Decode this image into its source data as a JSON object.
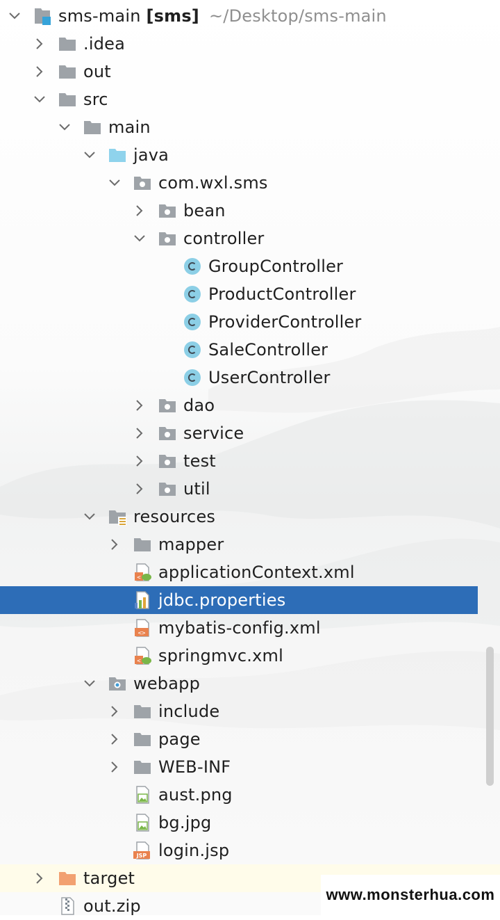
{
  "project": {
    "root": {
      "name": "sms-main",
      "module": "[sms]",
      "path": "~/Desktop/sms-main"
    }
  },
  "tree": [
    {
      "label": "sms-main [sms]  ~/Desktop/sms-main",
      "name": "root",
      "level": 0,
      "chev": "down",
      "icon": "module",
      "kind": "root"
    },
    {
      "label": ".idea",
      "name": "idea",
      "level": 1,
      "chev": "right",
      "icon": "folder-gray"
    },
    {
      "label": "out",
      "name": "out",
      "level": 1,
      "chev": "right",
      "icon": "folder-gray"
    },
    {
      "label": "src",
      "name": "src",
      "level": 1,
      "chev": "down",
      "icon": "folder-gray"
    },
    {
      "label": "main",
      "name": "main",
      "level": 2,
      "chev": "down",
      "icon": "folder-gray"
    },
    {
      "label": "java",
      "name": "java",
      "level": 3,
      "chev": "down",
      "icon": "folder-source"
    },
    {
      "label": "com.wxl.sms",
      "name": "com-wxl-sms",
      "level": 4,
      "chev": "down",
      "icon": "package"
    },
    {
      "label": "bean",
      "name": "bean",
      "level": 5,
      "chev": "right",
      "icon": "package"
    },
    {
      "label": "controller",
      "name": "controller",
      "level": 5,
      "chev": "down",
      "icon": "package"
    },
    {
      "label": "GroupController",
      "name": "group-controller",
      "level": 6,
      "chev": "none",
      "icon": "class"
    },
    {
      "label": "ProductController",
      "name": "product-controller",
      "level": 6,
      "chev": "none",
      "icon": "class"
    },
    {
      "label": "ProviderController",
      "name": "provider-controller",
      "level": 6,
      "chev": "none",
      "icon": "class"
    },
    {
      "label": "SaleController",
      "name": "sale-controller",
      "level": 6,
      "chev": "none",
      "icon": "class"
    },
    {
      "label": "UserController",
      "name": "user-controller",
      "level": 6,
      "chev": "none",
      "icon": "class"
    },
    {
      "label": "dao",
      "name": "dao",
      "level": 5,
      "chev": "right",
      "icon": "package"
    },
    {
      "label": "service",
      "name": "service",
      "level": 5,
      "chev": "right",
      "icon": "package"
    },
    {
      "label": "test",
      "name": "test",
      "level": 5,
      "chev": "right",
      "icon": "package"
    },
    {
      "label": "util",
      "name": "util",
      "level": 5,
      "chev": "right",
      "icon": "package"
    },
    {
      "label": "resources",
      "name": "resources",
      "level": 3,
      "chev": "down",
      "icon": "folder-resources"
    },
    {
      "label": "mapper",
      "name": "mapper",
      "level": 4,
      "chev": "right",
      "icon": "folder-gray"
    },
    {
      "label": "applicationContext.xml",
      "name": "application-context-xml",
      "level": 4,
      "chev": "none",
      "icon": "xml-spring"
    },
    {
      "label": "jdbc.properties",
      "name": "jdbc-properties",
      "level": 4,
      "chev": "none",
      "icon": "properties",
      "state": "selected"
    },
    {
      "label": "mybatis-config.xml",
      "name": "mybatis-config-xml",
      "level": 4,
      "chev": "none",
      "icon": "xml"
    },
    {
      "label": "springmvc.xml",
      "name": "springmvc-xml",
      "level": 4,
      "chev": "none",
      "icon": "xml-spring"
    },
    {
      "label": "webapp",
      "name": "webapp",
      "level": 3,
      "chev": "down",
      "icon": "folder-web"
    },
    {
      "label": "include",
      "name": "include",
      "level": 4,
      "chev": "right",
      "icon": "folder-gray"
    },
    {
      "label": "page",
      "name": "page",
      "level": 4,
      "chev": "right",
      "icon": "folder-gray"
    },
    {
      "label": "WEB-INF",
      "name": "web-inf",
      "level": 4,
      "chev": "right",
      "icon": "folder-gray"
    },
    {
      "label": "aust.png",
      "name": "aust-png",
      "level": 4,
      "chev": "none",
      "icon": "image"
    },
    {
      "label": "bg.jpg",
      "name": "bg-jpg",
      "level": 4,
      "chev": "none",
      "icon": "image"
    },
    {
      "label": "login.jsp",
      "name": "login-jsp",
      "level": 4,
      "chev": "none",
      "icon": "jsp"
    },
    {
      "label": "target",
      "name": "target",
      "level": 1,
      "chev": "right",
      "icon": "folder-orange",
      "state": "highlight"
    },
    {
      "label": "out.zip",
      "name": "out-zip",
      "level": 1,
      "chev": "none",
      "icon": "zip"
    }
  ],
  "watermark": "www.monsterhua.com",
  "colors": {
    "selection": "#2d6db7",
    "folder": "#9aa0a6",
    "source_folder": "#8fd3ec",
    "excluded_folder": "#f0a16c",
    "class_icon": "#8ccfe6",
    "highlight_row": "#fffcea"
  }
}
